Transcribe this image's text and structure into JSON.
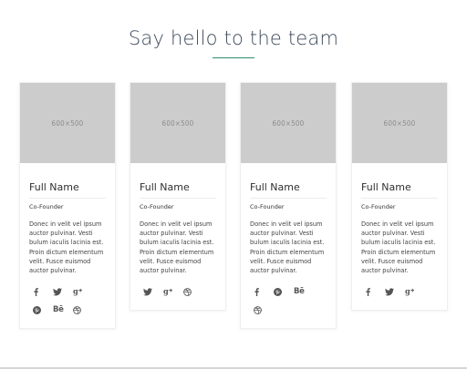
{
  "section": {
    "title": "Say hello to the team"
  },
  "image_placeholder": "600×500",
  "members": [
    {
      "name": "Full Name",
      "role": "Co-Founder",
      "bio": "Donec in velit vel ipsum auctor pulvinar. Vesti bulum iaculis lacinia est. Proin dictum elementum velit. Fusce euismod auctor pulvinar.",
      "socials": [
        "facebook-icon",
        "twitter-icon",
        "google-plus-icon",
        "pinterest-icon",
        "behance-icon",
        "dribbble-icon"
      ]
    },
    {
      "name": "Full Name",
      "role": "Co-Founder",
      "bio": "Donec in velit vel ipsum auctor pulvinar. Vesti bulum iaculis lacinia est. Proin dictum elementum velit. Fusce euismod auctor pulvinar.",
      "socials": [
        "twitter-icon",
        "google-plus-icon",
        "dribbble-icon"
      ]
    },
    {
      "name": "Full Name",
      "role": "Co-Founder",
      "bio": "Donec in velit vel ipsum auctor pulvinar. Vesti bulum iaculis lacinia est. Proin dictum elementum velit. Fusce euismod auctor pulvinar.",
      "socials": [
        "facebook-icon",
        "pinterest-icon",
        "behance-icon",
        "dribbble-icon"
      ]
    },
    {
      "name": "Full Name",
      "role": "Co-Founder",
      "bio": "Donec in velit vel ipsum auctor pulvinar. Vesti bulum iaculis lacinia est. Proin dictum elementum velit. Fusce euismod auctor pulvinar.",
      "socials": [
        "facebook-icon",
        "twitter-icon",
        "google-plus-icon"
      ]
    }
  ],
  "colors": {
    "accent": "#2a8f6a",
    "placeholder_bg": "#cccccc",
    "title": "#3d4a5a"
  }
}
